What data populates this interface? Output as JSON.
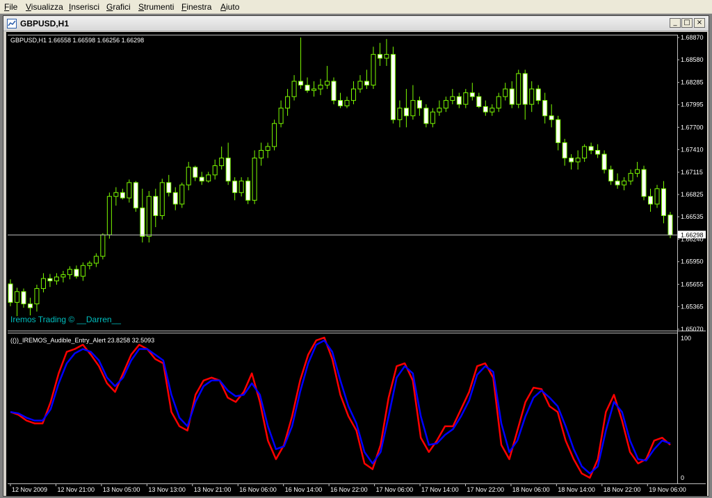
{
  "menu": [
    "File",
    "Visualizza",
    "Inserisci",
    "Grafici",
    "Strumenti",
    "Finestra",
    "Aiuto"
  ],
  "window": {
    "title": "GBPUSD,H1",
    "min_glyph": "_",
    "max_glyph": "□",
    "close_glyph": "×"
  },
  "price_panel": {
    "info": "GBPUSD,H1  1.66558 1.66598 1.66256 1.66298",
    "watermark": "Iremos Trading © __Darren__",
    "current_price_label": "1.66298",
    "axis_labels": [
      "1.68870",
      "1.68580",
      "1.68285",
      "1.67995",
      "1.67700",
      "1.67410",
      "1.67115",
      "1.66825",
      "1.66535",
      "1.66240",
      "1.65950",
      "1.65655",
      "1.65365",
      "1.65070"
    ]
  },
  "indicator_panel": {
    "label": "(())_IREMOS_Audible_Entry_Alert 23.8258 32.5093",
    "axis_top": "100",
    "axis_bottom": "0"
  },
  "time_axis": [
    "12 Nov 2009",
    "12 Nov 21:00",
    "13 Nov 05:00",
    "13 Nov 13:00",
    "13 Nov 21:00",
    "16 Nov 06:00",
    "16 Nov 14:00",
    "16 Nov 22:00",
    "17 Nov 06:00",
    "17 Nov 14:00",
    "17 Nov 22:00",
    "18 Nov 06:00",
    "18 Nov 14:00",
    "18 Nov 22:00",
    "19 Nov 06:00"
  ],
  "colors": {
    "background": "#000000",
    "candles": "#7cfc00",
    "candle_body_up": "#000000",
    "candle_body_down": "#ffffff",
    "grid": "#c0c0c0",
    "watermark": "#00bfbf",
    "fast_line": "#ff0000",
    "slow_line": "#0000ff"
  },
  "chart_data": [
    {
      "type": "candlestick",
      "symbol": "GBPUSD",
      "timeframe": "H1",
      "ylim": [
        1.6507,
        1.6887
      ],
      "last_price": 1.66298,
      "ohlc": [
        [
          1.6566,
          1.6572,
          1.6537,
          1.6542
        ],
        [
          1.6542,
          1.6561,
          1.6524,
          1.6556
        ],
        [
          1.6556,
          1.656,
          1.6535,
          1.654
        ],
        [
          1.654,
          1.6548,
          1.6525,
          1.6535
        ],
        [
          1.654,
          1.6565,
          1.653,
          1.656
        ],
        [
          1.656,
          1.658,
          1.6555,
          1.6573
        ],
        [
          1.6573,
          1.6579,
          1.6562,
          1.657
        ],
        [
          1.657,
          1.658,
          1.6565,
          1.6575
        ],
        [
          1.6575,
          1.6583,
          1.6568,
          1.6578
        ],
        [
          1.6578,
          1.6589,
          1.6572,
          1.6585
        ],
        [
          1.6585,
          1.659,
          1.6573,
          1.6576
        ],
        [
          1.6576,
          1.6594,
          1.657,
          1.659
        ],
        [
          1.659,
          1.6596,
          1.6585,
          1.6593
        ],
        [
          1.6593,
          1.6606,
          1.6588,
          1.6602
        ],
        [
          1.6602,
          1.6632,
          1.6598,
          1.663
        ],
        [
          1.663,
          1.6685,
          1.6625,
          1.668
        ],
        [
          1.668,
          1.6692,
          1.6668,
          1.6685
        ],
        [
          1.6685,
          1.669,
          1.6676,
          1.6678
        ],
        [
          1.6678,
          1.6702,
          1.6672,
          1.6698
        ],
        [
          1.6698,
          1.67,
          1.666,
          1.6665
        ],
        [
          1.6665,
          1.669,
          1.662,
          1.6628
        ],
        [
          1.6628,
          1.6687,
          1.662,
          1.668
        ],
        [
          1.668,
          1.669,
          1.664,
          1.6655
        ],
        [
          1.6655,
          1.6703,
          1.665,
          1.6698
        ],
        [
          1.6698,
          1.6708,
          1.668,
          1.6685
        ],
        [
          1.6685,
          1.6692,
          1.6662,
          1.667
        ],
        [
          1.667,
          1.6698,
          1.6665,
          1.6695
        ],
        [
          1.6695,
          1.6725,
          1.6688,
          1.6718
        ],
        [
          1.6718,
          1.672,
          1.67,
          1.6705
        ],
        [
          1.6705,
          1.6712,
          1.6695,
          1.67
        ],
        [
          1.67,
          1.6712,
          1.6698,
          1.6708
        ],
        [
          1.6708,
          1.6728,
          1.6702,
          1.672
        ],
        [
          1.672,
          1.6745,
          1.6715,
          1.673
        ],
        [
          1.673,
          1.675,
          1.6695,
          1.67
        ],
        [
          1.67,
          1.6705,
          1.6675,
          1.6685
        ],
        [
          1.6685,
          1.6705,
          1.668,
          1.67
        ],
        [
          1.67,
          1.6705,
          1.667,
          1.6675
        ],
        [
          1.6675,
          1.674,
          1.667,
          1.673
        ],
        [
          1.673,
          1.675,
          1.672,
          1.674
        ],
        [
          1.674,
          1.675,
          1.673,
          1.6745
        ],
        [
          1.6745,
          1.678,
          1.674,
          1.6775
        ],
        [
          1.6775,
          1.6805,
          1.677,
          1.6795
        ],
        [
          1.6795,
          1.682,
          1.6785,
          1.681
        ],
        [
          1.681,
          1.6838,
          1.6805,
          1.683
        ],
        [
          1.683,
          1.6887,
          1.682,
          1.6825
        ],
        [
          1.6825,
          1.6835,
          1.6815,
          1.6818
        ],
        [
          1.6818,
          1.683,
          1.681,
          1.682
        ],
        [
          1.682,
          1.6833,
          1.6812,
          1.6825
        ],
        [
          1.6825,
          1.685,
          1.682,
          1.683
        ],
        [
          1.683,
          1.6835,
          1.68,
          1.6805
        ],
        [
          1.6805,
          1.6815,
          1.6795,
          1.6798
        ],
        [
          1.6798,
          1.681,
          1.6795,
          1.6805
        ],
        [
          1.6805,
          1.683,
          1.68,
          1.682
        ],
        [
          1.682,
          1.6838,
          1.6815,
          1.683
        ],
        [
          1.683,
          1.6845,
          1.682,
          1.6825
        ],
        [
          1.6825,
          1.6875,
          1.682,
          1.6865
        ],
        [
          1.6865,
          1.688,
          1.685,
          1.686
        ],
        [
          1.686,
          1.6885,
          1.685,
          1.6865
        ],
        [
          1.6865,
          1.6875,
          1.6775,
          1.678
        ],
        [
          1.678,
          1.6805,
          1.677,
          1.6795
        ],
        [
          1.6795,
          1.682,
          1.677,
          1.6785
        ],
        [
          1.6785,
          1.6825,
          1.678,
          1.6805
        ],
        [
          1.6805,
          1.681,
          1.6785,
          1.6795
        ],
        [
          1.6795,
          1.68,
          1.677,
          1.6775
        ],
        [
          1.6775,
          1.6795,
          1.677,
          1.679
        ],
        [
          1.679,
          1.6805,
          1.6785,
          1.6795
        ],
        [
          1.6795,
          1.681,
          1.679,
          1.6805
        ],
        [
          1.6805,
          1.682,
          1.68,
          1.681
        ],
        [
          1.681,
          1.6815,
          1.6795,
          1.68
        ],
        [
          1.68,
          1.682,
          1.6795,
          1.6815
        ],
        [
          1.6815,
          1.6828,
          1.6805,
          1.681
        ],
        [
          1.681,
          1.6815,
          1.6795,
          1.6797
        ],
        [
          1.6797,
          1.6805,
          1.6785,
          1.679
        ],
        [
          1.679,
          1.68,
          1.6785,
          1.6795
        ],
        [
          1.6795,
          1.6815,
          1.679,
          1.681
        ],
        [
          1.681,
          1.6828,
          1.6805,
          1.682
        ],
        [
          1.682,
          1.683,
          1.6795,
          1.68
        ],
        [
          1.68,
          1.6845,
          1.6795,
          1.684
        ],
        [
          1.684,
          1.6845,
          1.678,
          1.68
        ],
        [
          1.68,
          1.683,
          1.679,
          1.682
        ],
        [
          1.682,
          1.6825,
          1.68,
          1.6805
        ],
        [
          1.6805,
          1.6815,
          1.6775,
          1.6785
        ],
        [
          1.6785,
          1.68,
          1.677,
          1.678
        ],
        [
          1.678,
          1.6785,
          1.674,
          1.675
        ],
        [
          1.675,
          1.6755,
          1.672,
          1.673
        ],
        [
          1.673,
          1.6735,
          1.6715,
          1.6725
        ],
        [
          1.6725,
          1.674,
          1.6715,
          1.673
        ],
        [
          1.673,
          1.6748,
          1.6725,
          1.6745
        ],
        [
          1.6745,
          1.675,
          1.6735,
          1.674
        ],
        [
          1.674,
          1.6748,
          1.673,
          1.6735
        ],
        [
          1.6735,
          1.674,
          1.671,
          1.6715
        ],
        [
          1.6715,
          1.672,
          1.6695,
          1.67
        ],
        [
          1.67,
          1.671,
          1.669,
          1.6695
        ],
        [
          1.6695,
          1.6705,
          1.6688,
          1.67
        ],
        [
          1.67,
          1.6715,
          1.6695,
          1.671
        ],
        [
          1.671,
          1.6725,
          1.6705,
          1.6715
        ],
        [
          1.6715,
          1.672,
          1.6675,
          1.668
        ],
        [
          1.668,
          1.669,
          1.666,
          1.667
        ],
        [
          1.667,
          1.6695,
          1.6665,
          1.669
        ],
        [
          1.669,
          1.67,
          1.6645,
          1.6655
        ],
        [
          1.66558,
          1.66598,
          1.66256,
          1.66298
        ]
      ]
    },
    {
      "type": "line",
      "title": "(())_IREMOS_Audible_Entry_Alert",
      "ylim": [
        0,
        100
      ],
      "series": [
        {
          "values": [
            48,
            46,
            42,
            40,
            40,
            55,
            75,
            90,
            92,
            95,
            88,
            80,
            68,
            62,
            75,
            88,
            95,
            92,
            85,
            82,
            48,
            38,
            35,
            60,
            70,
            72,
            70,
            58,
            55,
            62,
            75,
            55,
            28,
            15,
            25,
            45,
            70,
            88,
            98,
            100,
            85,
            60,
            45,
            35,
            12,
            8,
            25,
            58,
            80,
            82,
            70,
            30,
            20,
            28,
            38,
            38,
            50,
            62,
            80,
            82,
            72,
            25,
            15,
            35,
            55,
            65,
            64,
            52,
            48,
            28,
            15,
            5,
            2,
            15,
            48,
            60,
            42,
            20,
            12,
            15,
            28,
            30,
            25
          ]
        },
        {
          "values": [
            48,
            47,
            44,
            42,
            42,
            50,
            68,
            82,
            89,
            92,
            90,
            84,
            72,
            66,
            72,
            84,
            92,
            92,
            88,
            84,
            60,
            44,
            38,
            55,
            66,
            70,
            70,
            63,
            59,
            60,
            68,
            60,
            38,
            22,
            24,
            38,
            62,
            82,
            95,
            98,
            90,
            70,
            52,
            40,
            20,
            12,
            20,
            45,
            72,
            80,
            75,
            45,
            25,
            26,
            32,
            36,
            45,
            56,
            74,
            80,
            76,
            40,
            20,
            28,
            45,
            58,
            63,
            58,
            52,
            38,
            22,
            10,
            5,
            10,
            35,
            55,
            48,
            28,
            15,
            14,
            22,
            28,
            26
          ]
        }
      ]
    }
  ]
}
